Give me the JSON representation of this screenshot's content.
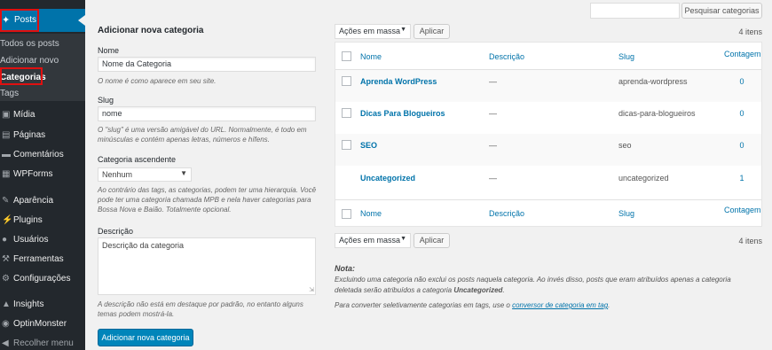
{
  "sidebar": {
    "posts_label": "Posts",
    "submenu": [
      "Todos os posts",
      "Adicionar novo",
      "Categorias",
      "Tags"
    ],
    "items": [
      {
        "label": "Mídia",
        "icon": "media-icon"
      },
      {
        "label": "Páginas",
        "icon": "pages-icon"
      },
      {
        "label": "Comentários",
        "icon": "comments-icon"
      },
      {
        "label": "WPForms",
        "icon": "wpforms-icon"
      },
      {
        "label": "Aparência",
        "icon": "appearance-icon"
      },
      {
        "label": "Plugins",
        "icon": "plugins-icon"
      },
      {
        "label": "Usuários",
        "icon": "users-icon"
      },
      {
        "label": "Ferramentas",
        "icon": "tools-icon"
      },
      {
        "label": "Configurações",
        "icon": "settings-icon"
      },
      {
        "label": "Insights",
        "icon": "insights-icon"
      },
      {
        "label": "OptinMonster",
        "icon": "optinmonster-icon"
      },
      {
        "label": "Recolher menu",
        "icon": "collapse-icon"
      }
    ]
  },
  "search": {
    "button_label": "Pesquisar categorias",
    "value": ""
  },
  "form": {
    "heading": "Adicionar nova categoria",
    "name_label": "Nome",
    "name_value": "Nome da Categoria",
    "name_help": "O nome é como aparece em seu site.",
    "slug_label": "Slug",
    "slug_value": "nome",
    "slug_help": "O \"slug\" é uma versão amigável do URL. Normalmente, é todo em minúsculas e contém apenas letras, números e hífens.",
    "parent_label": "Categoria ascendente",
    "parent_value": "Nenhum",
    "parent_help": "Ao contrário das tags, as categorias, podem ter uma hierarquia. Você pode ter uma categoria chamada MPB e nela haver categorias para Bossa Nova e Baião. Totalmente opcional.",
    "desc_label": "Descrição",
    "desc_value": "Descrição da categoria",
    "desc_help": "A descrição não está em destaque por padrão, no entanto alguns temas podem mostrá-la.",
    "submit_label": "Adicionar nova categoria"
  },
  "bulk": {
    "select_label": "Ações em massa",
    "apply_label": "Aplicar",
    "items_count": "4 itens"
  },
  "table": {
    "columns": [
      "Nome",
      "Descrição",
      "Slug",
      "Contagem"
    ],
    "rows": [
      {
        "name": "Aprenda WordPress",
        "description": "—",
        "slug": "aprenda-wordpress",
        "count": "0"
      },
      {
        "name": "Dicas Para Blogueiros",
        "description": "—",
        "slug": "dicas-para-blogueiros",
        "count": "0"
      },
      {
        "name": "SEO",
        "description": "—",
        "slug": "seo",
        "count": "0"
      },
      {
        "name": "Uncategorized",
        "description": "—",
        "slug": "uncategorized",
        "count": "1"
      }
    ]
  },
  "note": {
    "title": "Nota:",
    "text_before": "Excluindo uma categoria não exclui os posts naquela categoria. Ao invés disso, posts que eram atribuídos apenas a categoria deletada serão atribuídos a categoria ",
    "text_bold": "Uncategorized",
    "text_after": ".",
    "convert_before": "Para converter seletivamente categorias em tags, use o ",
    "convert_link": "conversor de categoria em tag",
    "convert_after": "."
  },
  "colors": {
    "sidebar_bg": "#23282d",
    "accent": "#0073aa",
    "primary_button": "#0085ba",
    "highlight_border": "#e01010"
  }
}
